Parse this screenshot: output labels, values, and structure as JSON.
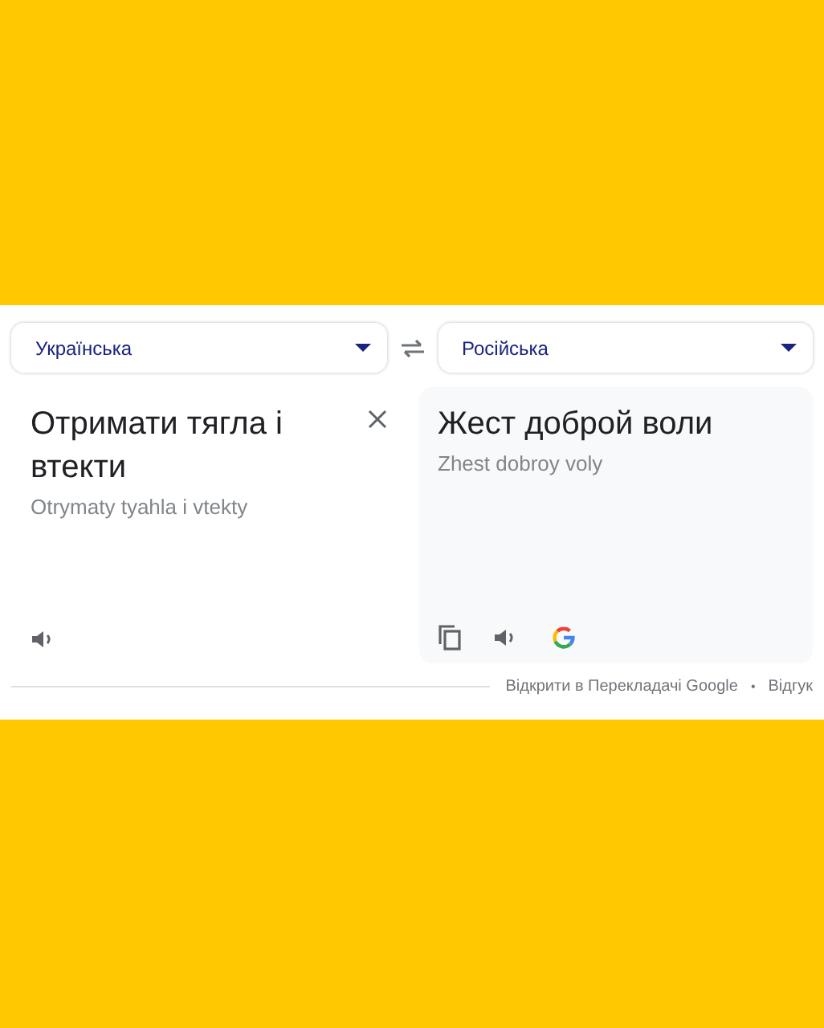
{
  "source_language": {
    "label": "Українська"
  },
  "target_language": {
    "label": "Російська"
  },
  "source": {
    "text": "Отримати тягла і втекти",
    "transliteration": "Otrymaty tyahla i vtekty"
  },
  "target": {
    "text": "Жест доброй воли",
    "transliteration": "Zhest dobroy voly"
  },
  "footer": {
    "links": [
      "Відкрити в Перекладачі Google",
      "Відгук"
    ],
    "separator": "•"
  }
}
